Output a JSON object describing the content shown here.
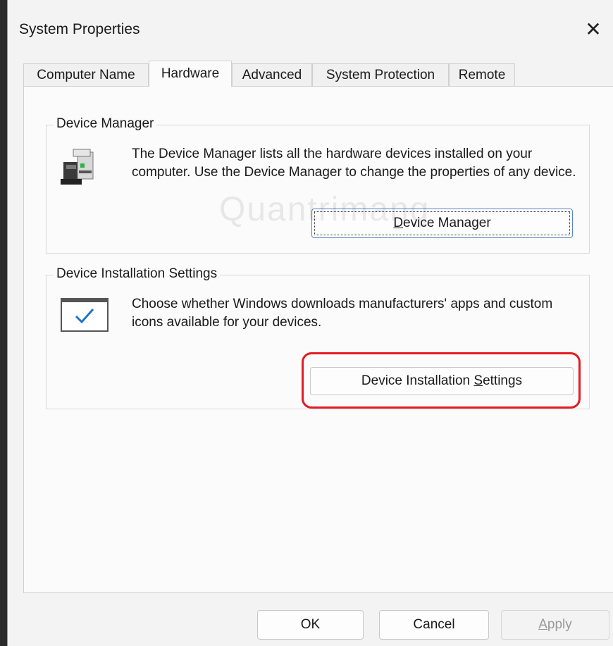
{
  "window": {
    "title": "System Properties",
    "close_glyph": "✕"
  },
  "tabs": [
    {
      "label": "Computer Name",
      "active": false
    },
    {
      "label": "Hardware",
      "active": true
    },
    {
      "label": "Advanced",
      "active": false
    },
    {
      "label": "System Protection",
      "active": false
    },
    {
      "label": "Remote",
      "active": false
    }
  ],
  "device_manager": {
    "legend": "Device Manager",
    "icon": "device-manager-icon",
    "description": "The Device Manager lists all the hardware devices installed on your computer. Use the Device Manager to change the properties of any device.",
    "button_pre": "",
    "button_mnemonic": "D",
    "button_post": "evice Manager"
  },
  "device_install": {
    "legend": "Device Installation Settings",
    "icon": "checkbox-window-icon",
    "description": "Choose whether Windows downloads manufacturers' apps and custom icons available for your devices.",
    "button_pre": "Device Installation ",
    "button_mnemonic": "S",
    "button_post": "ettings"
  },
  "footer": {
    "ok": "OK",
    "cancel": "Cancel",
    "apply_mnemonic": "A",
    "apply_rest": "pply"
  },
  "watermark": "Quantrimang",
  "colors": {
    "highlight": "#e31b23",
    "focus": "#5b86c6"
  }
}
